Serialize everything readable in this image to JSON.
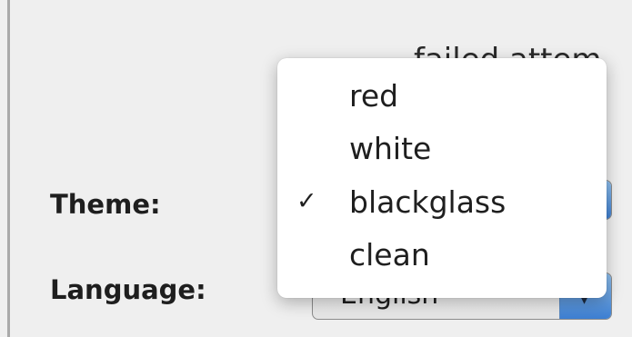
{
  "background": {
    "partial_text": "failed attem"
  },
  "form": {
    "theme_label": "Theme:",
    "language_label": "Language:",
    "language_value": "English"
  },
  "theme_menu": {
    "items": [
      {
        "label": "red",
        "checked": false
      },
      {
        "label": "white",
        "checked": false
      },
      {
        "label": "blackglass",
        "checked": true
      },
      {
        "label": "clean",
        "checked": false
      }
    ],
    "check_mark": "✓"
  },
  "colors": {
    "accent_arrow": "#3d7fd2",
    "menu_background": "#ffffff",
    "window_background": "#efefef"
  }
}
